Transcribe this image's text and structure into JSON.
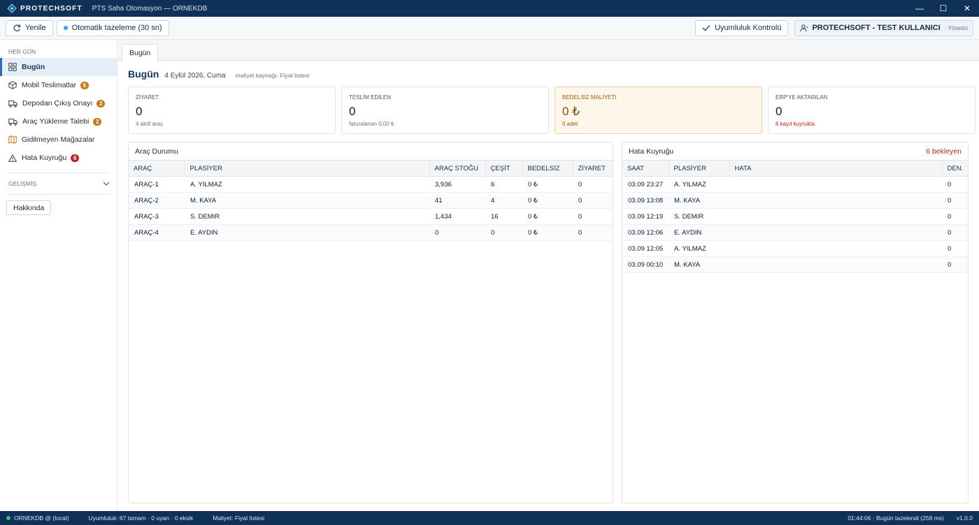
{
  "titlebar": {
    "brand": "PROTECHSOFT",
    "title": "PTS Saha Otomasyon — ORNEKDB",
    "minimize": "—",
    "maximize": "☐",
    "close": "✕"
  },
  "toolbar": {
    "refresh_label": "Yenile",
    "auto_refresh_label": "Otomatik tazeleme (30 sn)",
    "compliance_label": "Uyumluluk Kontrolü",
    "user_name": "PROTECHSOFT - TEST KULLANICI",
    "user_role": "· Yönetici"
  },
  "sidebar": {
    "section_label": "HER GÜN",
    "items": [
      {
        "label": "Bugün",
        "badge": ""
      },
      {
        "label": "Mobil Teslimatlar",
        "badge": "6"
      },
      {
        "label": "Depodan Çıkış Onayı",
        "badge": "2"
      },
      {
        "label": "Araç Yükleme Talebi",
        "badge": "2"
      },
      {
        "label": "Gidilmeyen Mağazalar",
        "badge": ""
      },
      {
        "label": "Hata Kuyruğu",
        "badge": "6"
      }
    ],
    "advanced_label": "GELİŞMİŞ",
    "about_label": "Hakkında"
  },
  "tabs": [
    {
      "label": "Bugün"
    }
  ],
  "page": {
    "title": "Bugün",
    "date": "4 Eylül 2026, Cuma",
    "cost_source": "maliyet kaynağı: Fiyat listesi"
  },
  "cards": [
    {
      "label": "ZİYARET",
      "value": "0",
      "sub": "4 aktif araç"
    },
    {
      "label": "TESLİM EDİLEN",
      "value": "0",
      "sub": "faturalanan 0,00 ₺"
    },
    {
      "label": "BEDELSİZ MALİYETİ",
      "value": "0 ₺",
      "sub": "0 adet"
    },
    {
      "label": "ERP'YE AKTARILAN",
      "value": "0",
      "sub": "6 kayıt kuyrukta"
    }
  ],
  "vehicles": {
    "title": "Araç Durumu",
    "columns": [
      "ARAÇ",
      "PLASİYER",
      "ARAÇ STOĞU",
      "ÇEŞİT",
      "BEDELSİZ",
      "ZİYARET"
    ],
    "rows": [
      [
        "ARAÇ-1",
        "A. YILMAZ",
        "3,936",
        "6",
        "0 ₺",
        "0"
      ],
      [
        "ARAÇ-2",
        "M. KAYA",
        "41",
        "4",
        "0 ₺",
        "0"
      ],
      [
        "ARAÇ-3",
        "S. DEMIR",
        "1,434",
        "16",
        "0 ₺",
        "0"
      ],
      [
        "ARAÇ-4",
        "E. AYDIN",
        "0",
        "0",
        "0 ₺",
        "0"
      ]
    ]
  },
  "errors": {
    "title": "Hata Kuyruğu",
    "pending": "6 bekleyen",
    "columns": [
      "SAAT",
      "PLASİYER",
      "HATA",
      "DEN."
    ],
    "rows": [
      [
        "03.09 23:27",
        "A. YILMAZ",
        "",
        "0"
      ],
      [
        "03.09 13:08",
        "M. KAYA",
        "",
        "0"
      ],
      [
        "03.09 12:19",
        "S. DEMIR",
        "",
        "0"
      ],
      [
        "03.09 12:06",
        "E. AYDIN",
        "",
        "0"
      ],
      [
        "03.09 12:05",
        "A. YILMAZ",
        "",
        "0"
      ],
      [
        "03.09 00:10",
        "M. KAYA",
        "",
        "0"
      ]
    ]
  },
  "statusbar": {
    "db": "ORNEKDB @ (local)",
    "compliance": "Uyumluluk: 67 tamam · 0 uyarı · 0 eksik",
    "cost": "Maliyet: Fiyat listesi",
    "refreshed": "01:44:06 · Bugün tazelendi (258 ms)",
    "version": "v1.0.0"
  },
  "colors": {
    "titlebar": "#0f3057",
    "accent": "#2f6db5",
    "badge_orange": "#c27b16",
    "badge_red": "#b42323",
    "warn_card": "#fdf6ea"
  }
}
